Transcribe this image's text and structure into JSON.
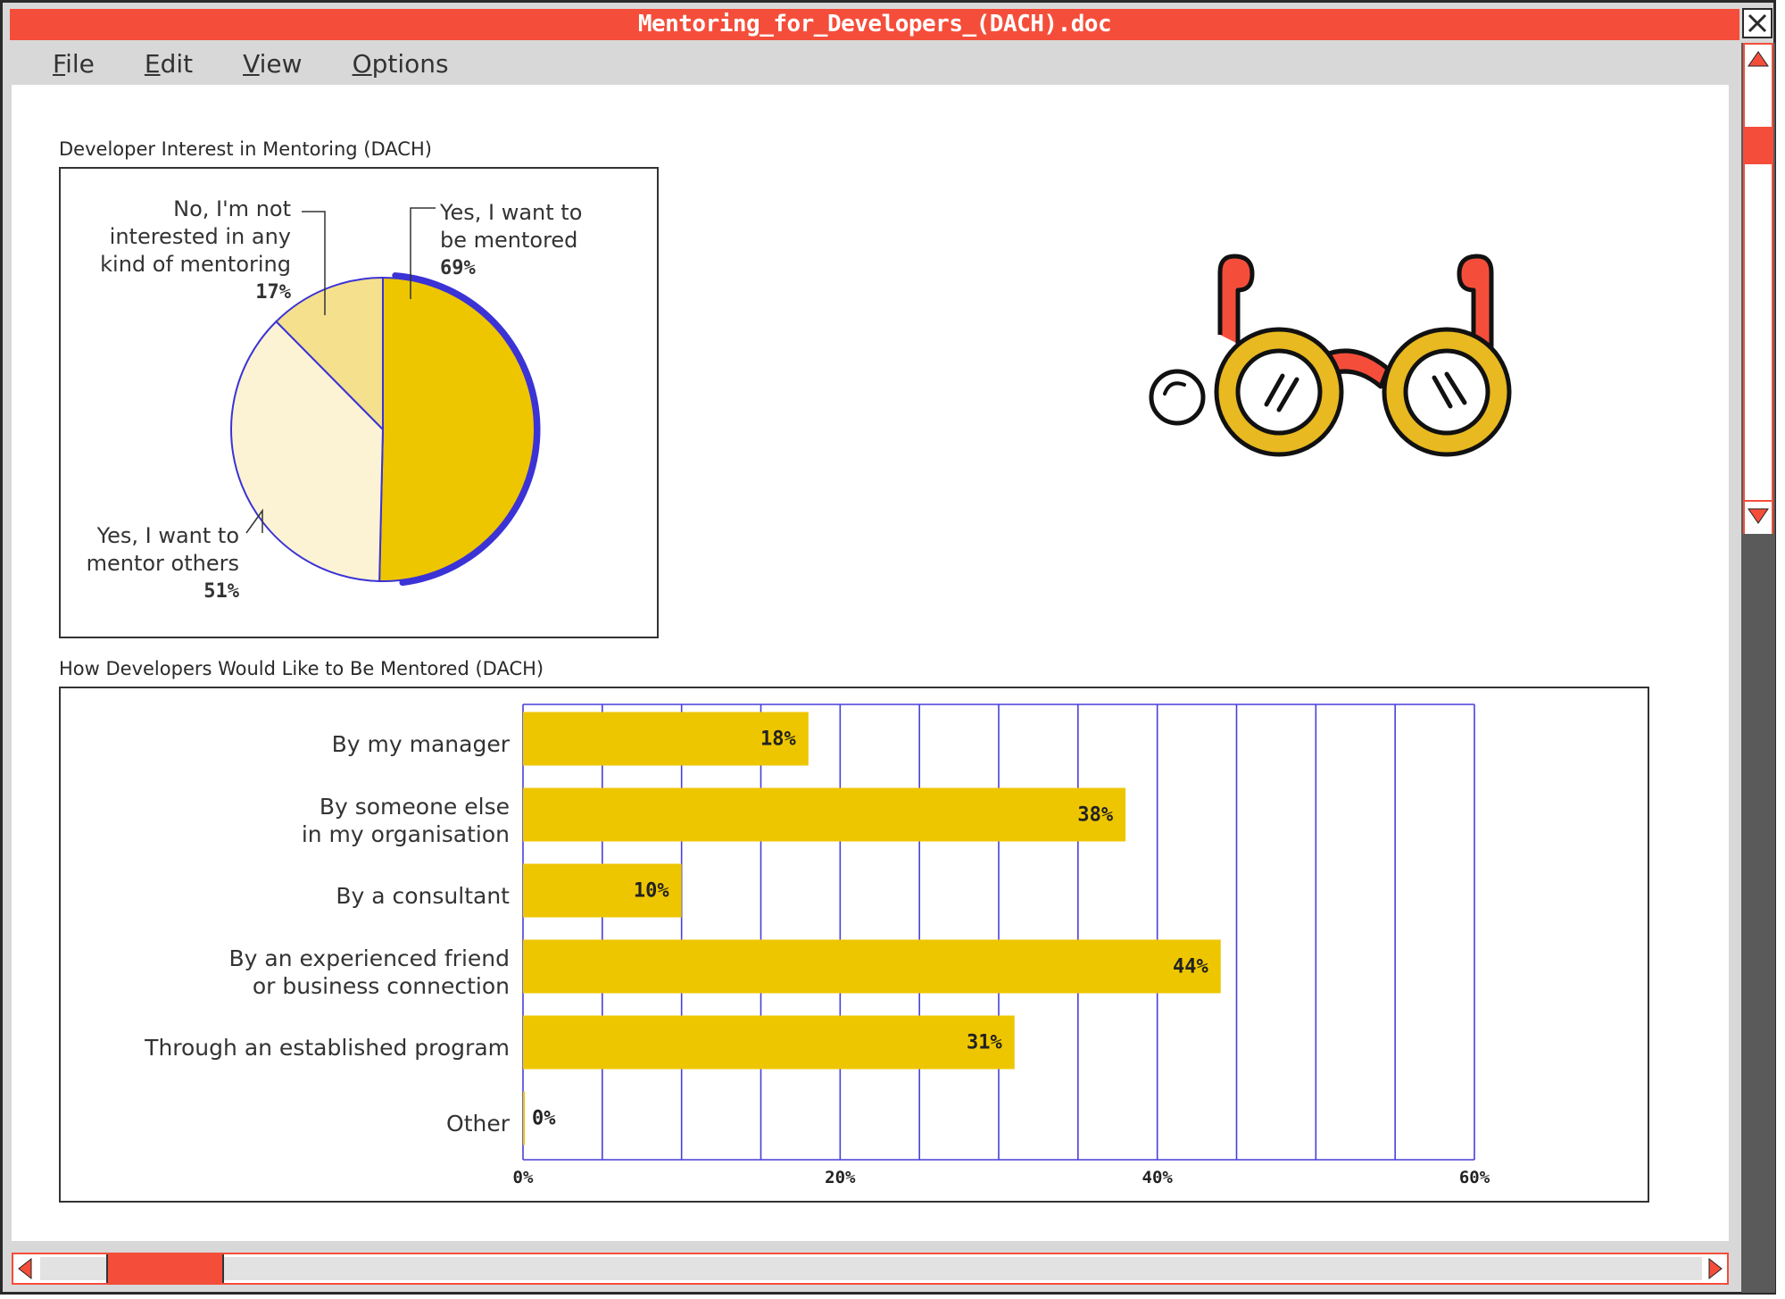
{
  "window": {
    "title": "Mentoring_for_Developers_(DACH).doc"
  },
  "menu": {
    "items": [
      "File",
      "Edit",
      "View",
      "Options"
    ]
  },
  "colors": {
    "accent": "#f44e3b",
    "bar": "#eec600",
    "grid": "#4a3fd8",
    "pie_main": "#eec600",
    "pie_light": "#fbf3d4",
    "pie_mid": "#f5e08e",
    "pie_outline": "#3b33d6"
  },
  "icons": {
    "illustration": "glasses-icon",
    "close": "close-icon",
    "scroll_up": "arrow-up-icon",
    "scroll_down": "arrow-down-icon",
    "scroll_left": "arrow-left-icon",
    "scroll_right": "arrow-right-icon"
  },
  "chart_data": [
    {
      "type": "pie",
      "title": "Developer Interest in Mentoring (DACH)",
      "slices": [
        {
          "label": "Yes, I want to be mentored",
          "label_lines": [
            "Yes, I want to",
            "be mentored"
          ],
          "value": 69,
          "value_label": "69%"
        },
        {
          "label": "Yes, I want to mentor others",
          "label_lines": [
            "Yes, I want to",
            "mentor others"
          ],
          "value": 51,
          "value_label": "51%"
        },
        {
          "label": "No, I'm not interested in any kind of mentoring",
          "label_lines": [
            "No, I'm not",
            "interested in any",
            "kind of mentoring"
          ],
          "value": 17,
          "value_label": "17%"
        }
      ]
    },
    {
      "type": "bar",
      "orientation": "horizontal",
      "title": "How Developers Would Like to Be Mentored (DACH)",
      "categories": [
        "By my manager",
        "By someone else\nin my organisation",
        "By a consultant",
        "By an experienced friend\nor business connection",
        "Through an established program",
        "Other"
      ],
      "values": [
        18,
        38,
        10,
        44,
        31,
        0
      ],
      "value_labels": [
        "18%",
        "38%",
        "10%",
        "44%",
        "31%",
        "0%"
      ],
      "xlim": [
        0,
        60
      ],
      "xticks": [
        0,
        20,
        40,
        60
      ],
      "xtick_labels": [
        "0%",
        "20%",
        "40%",
        "60%"
      ],
      "grid": true
    }
  ]
}
